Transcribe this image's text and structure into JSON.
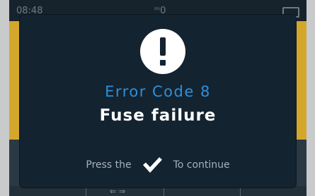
{
  "status_bar": {
    "time": "08:48",
    "center": "ᵐ0"
  },
  "dialog": {
    "icon": "exclamation-icon",
    "error_code": "Error Code 8",
    "error_message": "Fuse failure",
    "instruction_before": "Press the",
    "instruction_icon": "checkmark-icon",
    "instruction_after": "To continue"
  },
  "background": {
    "arrows": "⇐ ⇒"
  },
  "colors": {
    "accent_blue": "#2f8fd8",
    "dialog_bg": "#142330",
    "background_yellow": "#d4a72c"
  }
}
